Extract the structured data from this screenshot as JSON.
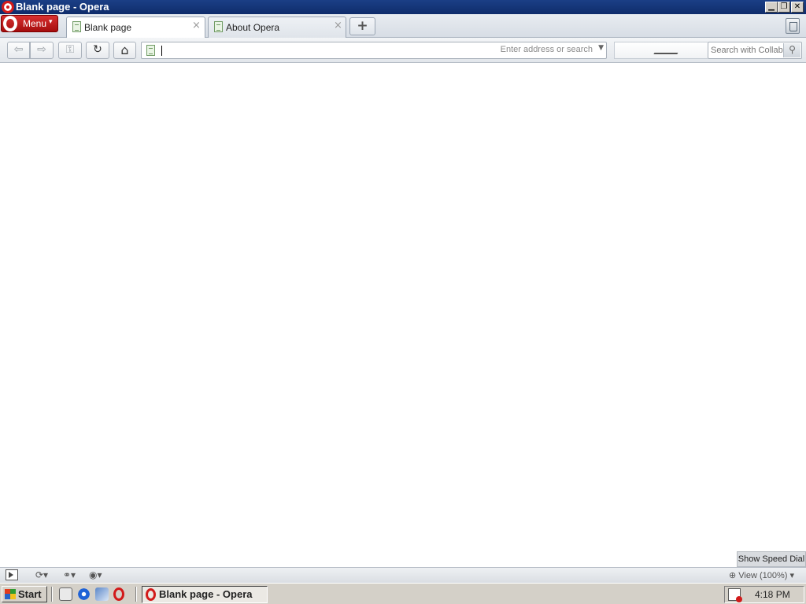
{
  "window": {
    "title": "Blank page - Opera",
    "minimize_glyph": "▁",
    "restore_glyph": "❐",
    "close_glyph": "✕"
  },
  "tabbar": {
    "menu_label": "Menu",
    "menu_caret": "▾",
    "tabs": [
      {
        "label": "Blank page",
        "close": "×",
        "active": true
      },
      {
        "label": "About Opera",
        "close": "×",
        "active": false
      }
    ],
    "new_tab_glyph": "+"
  },
  "toolbar": {
    "back_glyph": "⇦",
    "forward_glyph": "⇨",
    "key_glyph": "⚿",
    "reload_glyph": "↻",
    "home_glyph": "⌂",
    "address": {
      "value": "",
      "hint": "Enter address or search",
      "dropdown_glyph": "▼"
    },
    "search": {
      "placeholder": "Search with Collab'",
      "button_glyph": "⚲"
    }
  },
  "status": {
    "speed_dial_label": "Show Speed Dial",
    "sync_glyph": "⟳▾",
    "unite_glyph": "⚭▾",
    "turbo_glyph": "◉▾",
    "zoom_label": "⊕ View (100%) ▾"
  },
  "taskbar": {
    "start_label": "Start",
    "task_label": "Blank page - Opera",
    "clock": "4:18 PM"
  },
  "colors": {
    "title_bar": "#0f2c6b",
    "opera_red": "#d21a1a"
  }
}
